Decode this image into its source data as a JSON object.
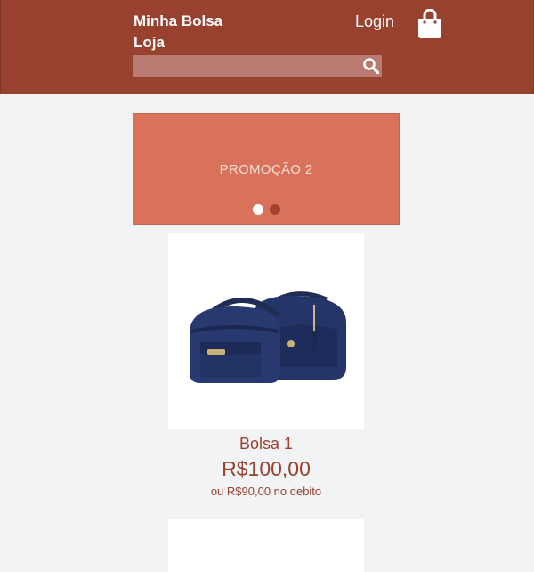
{
  "header": {
    "brand_line1": "Minha Bolsa",
    "brand_line2": "Loja",
    "login_label": "Login",
    "cart_icon": "shopping-bag-icon",
    "search": {
      "value": "",
      "placeholder": "",
      "icon": "search-icon"
    }
  },
  "banner": {
    "text": "PROMOÇÃO 2",
    "slides": 2,
    "active_slide": 1
  },
  "products": [
    {
      "name": "Bolsa 1",
      "price": "R$100,00",
      "debit_price": "ou R$90,00 no debito",
      "image": "navy-handbags-image"
    }
  ],
  "colors": {
    "header_bg": "#99412f",
    "banner_bg": "#d9725b",
    "accent_text": "#99412f",
    "page_bg": "#f2f3f5"
  }
}
